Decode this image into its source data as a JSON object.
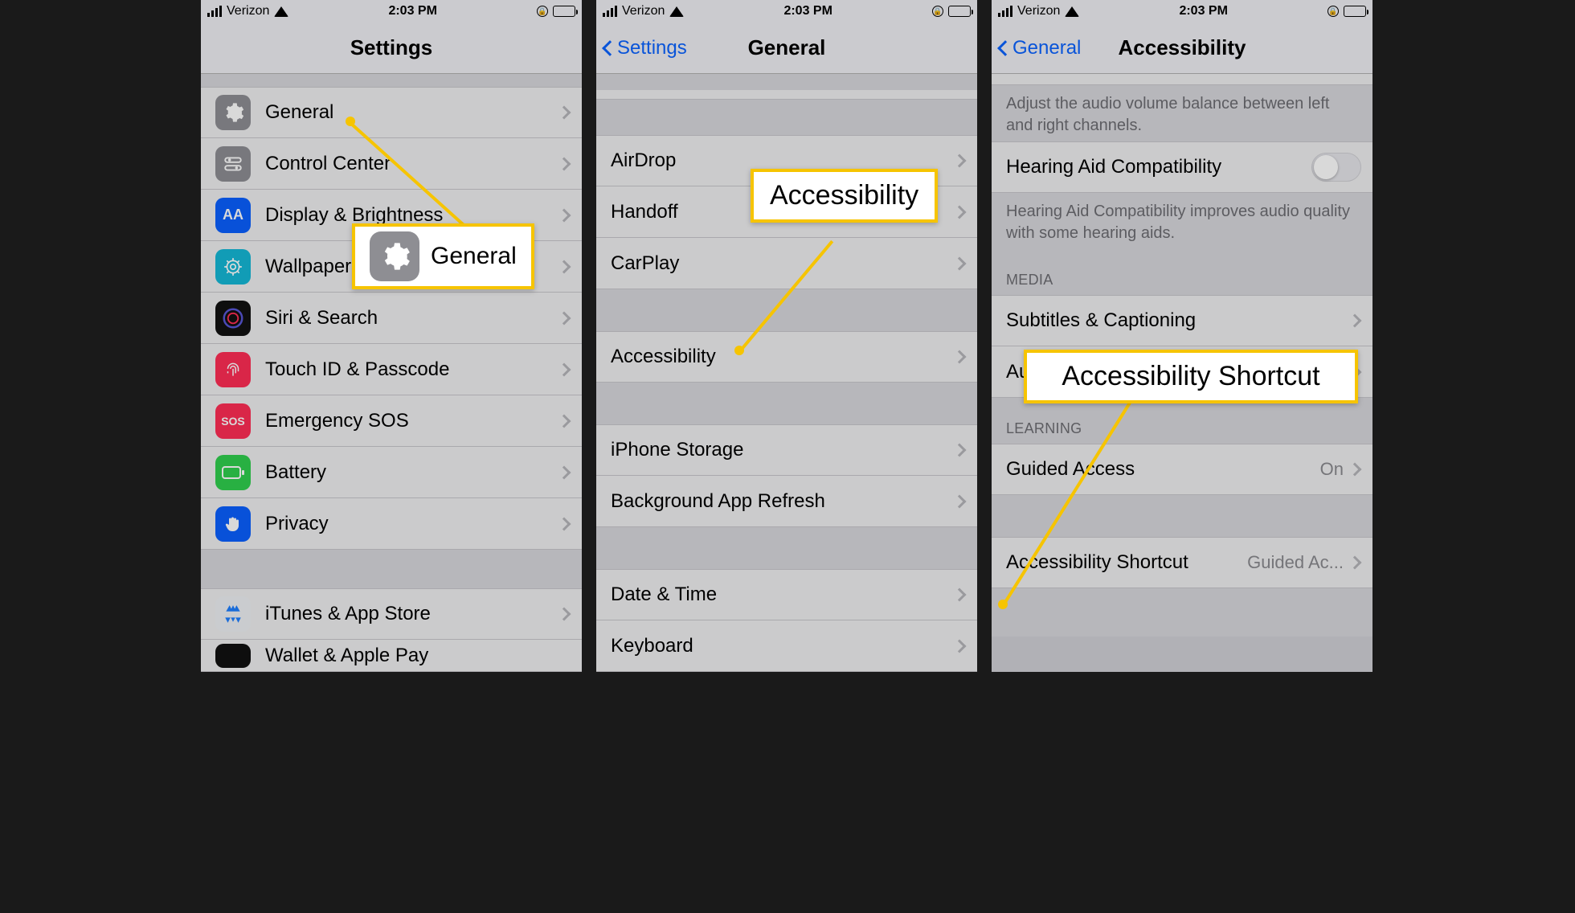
{
  "status": {
    "carrier": "Verizon",
    "time": "2:03 PM"
  },
  "screen1": {
    "title": "Settings",
    "items": [
      {
        "label": "General"
      },
      {
        "label": "Control Center"
      },
      {
        "label": "Display & Brightness"
      },
      {
        "label": "Wallpaper"
      },
      {
        "label": "Siri & Search"
      },
      {
        "label": "Touch ID & Passcode"
      },
      {
        "label": "Emergency SOS"
      },
      {
        "label": "Battery"
      },
      {
        "label": "Privacy"
      }
    ],
    "items2": [
      {
        "label": "iTunes & App Store"
      },
      {
        "label": "Wallet & Apple Pay"
      }
    ],
    "callout": "General"
  },
  "screen2": {
    "back": "Settings",
    "title": "General",
    "g1": [
      "AirDrop",
      "Handoff",
      "CarPlay"
    ],
    "g2": [
      "Accessibility"
    ],
    "g3": [
      "iPhone Storage",
      "Background App Refresh"
    ],
    "g4": [
      "Date & Time",
      "Keyboard"
    ],
    "callout": "Accessibility"
  },
  "screen3": {
    "back": "General",
    "title": "Accessibility",
    "balance_footer": "Adjust the audio volume balance between left and right channels.",
    "hearing_aid": "Hearing Aid Compatibility",
    "hearing_footer": "Hearing Aid Compatibility improves audio quality with some hearing aids.",
    "media_header": "MEDIA",
    "subtitles": "Subtitles & Captioning",
    "audio_desc": "Audio Descriptions",
    "learning_header": "LEARNING",
    "guided": "Guided Access",
    "guided_val": "On",
    "shortcut": "Accessibility Shortcut",
    "shortcut_val": "Guided Ac...",
    "callout": "Accessibility Shortcut"
  }
}
